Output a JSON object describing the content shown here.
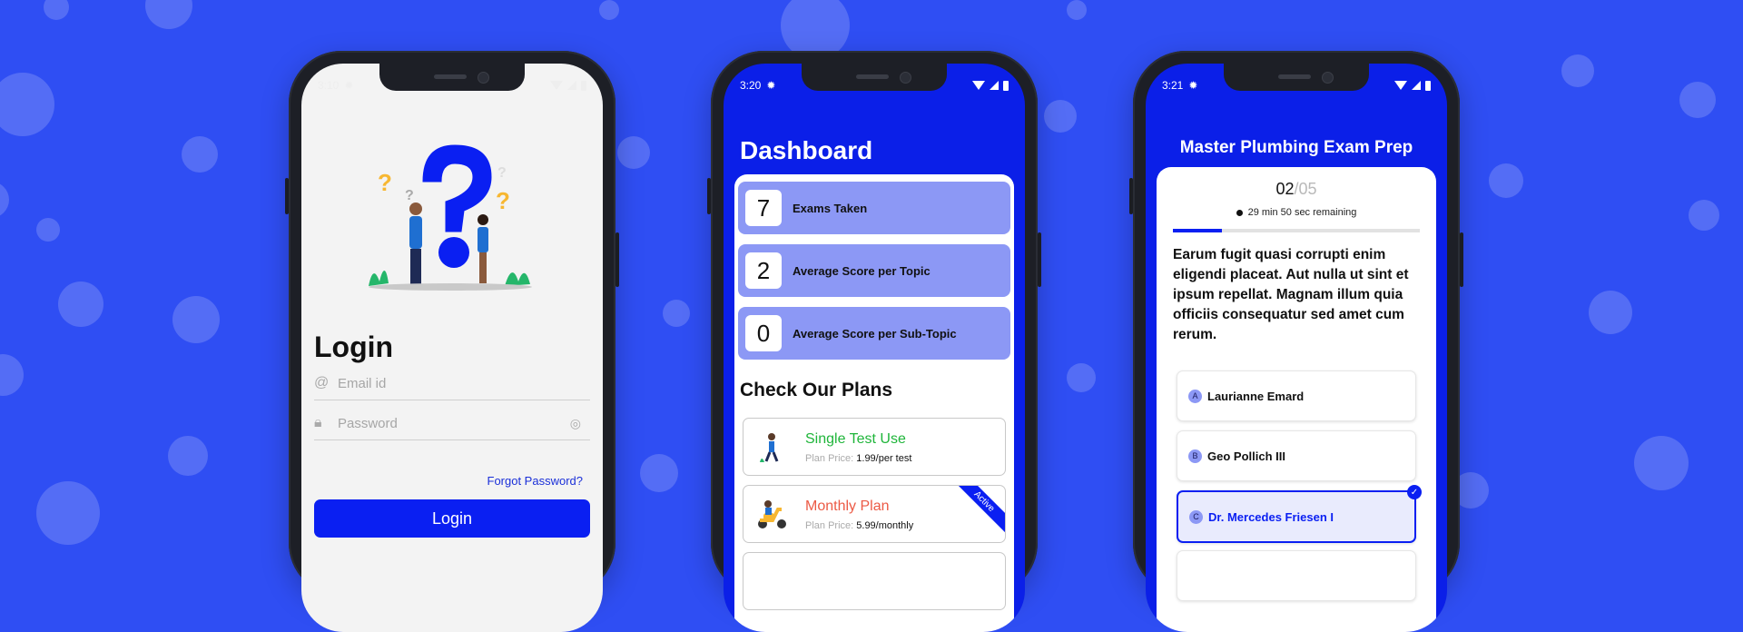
{
  "phones": {
    "login": {
      "status_time": "3:10",
      "title": "Login",
      "email_placeholder": "Email id",
      "password_placeholder": "Password",
      "forgot_label": "Forgot Password?",
      "login_button": "Login",
      "icons": [
        "settings-icon",
        "wifi-icon",
        "signal-icon",
        "battery-icon",
        "at-icon",
        "lock-icon",
        "eye-off-icon"
      ]
    },
    "dashboard": {
      "status_time": "3:20",
      "title": "Dashboard",
      "stats": [
        {
          "value": "7",
          "label": "Exams Taken"
        },
        {
          "value": "2",
          "label": "Average Score per Topic"
        },
        {
          "value": "0",
          "label": "Average Score per Sub-Topic"
        }
      ],
      "plans_title": "Check Our Plans",
      "plans": [
        {
          "name": "Single Test Use",
          "price_key": "Plan Price:",
          "price": "1.99/per test",
          "color": "#1fb53a",
          "active": false
        },
        {
          "name": "Monthly Plan",
          "price_key": "Plan Price:",
          "price": "5.99/monthly",
          "color": "#ec5a45",
          "active": true,
          "badge": "Active"
        }
      ]
    },
    "exam": {
      "status_time": "3:21",
      "title": "Master Plumbing Exam Prep",
      "current": "02",
      "total": "/05",
      "timer": "29 min 50 sec remaining",
      "progress": 0.2,
      "question": "Earum fugit quasi corrupti enim eligendi placeat. Aut nulla ut sint et ipsum repellat. Magnam illum quia officiis consequatur sed amet cum rerum.",
      "options": [
        {
          "letter": "A",
          "text": "Laurianne Emard",
          "selected": false
        },
        {
          "letter": "B",
          "text": "Geo Pollich III",
          "selected": false
        },
        {
          "letter": "C",
          "text": "Dr. Mercedes Friesen I",
          "selected": true
        }
      ]
    }
  },
  "colors": {
    "background": "#2f4ef3",
    "primary": "#0a1ff2",
    "stat_bg": "#8c98f5"
  }
}
